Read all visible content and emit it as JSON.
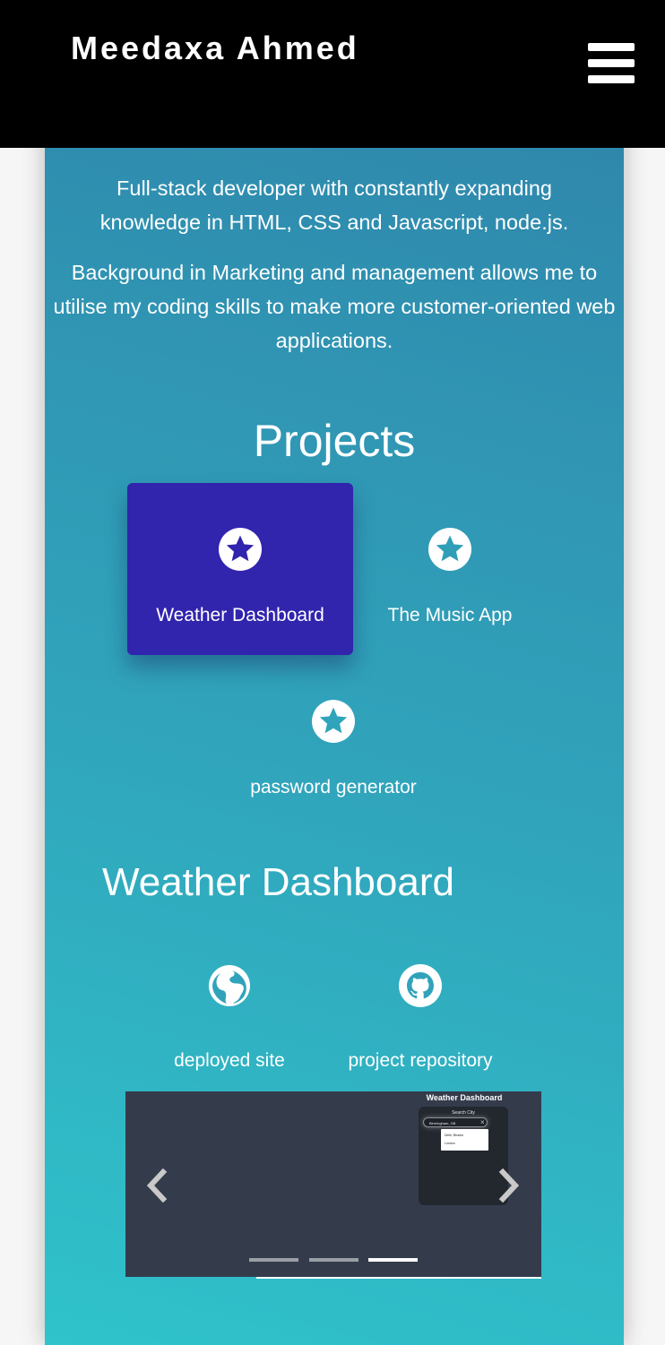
{
  "header": {
    "brand": "Meedaxa Ahmed",
    "menu_icon": "hamburger-menu-icon"
  },
  "intro": {
    "line1": "Full-stack developer with constantly expanding knowledge in HTML, CSS and Javascript, node.js.",
    "line2": "Background in Marketing and management allows me to utilise my coding skills to make more customer-oriented web applications."
  },
  "projects": {
    "title": "Projects",
    "items": [
      {
        "label": "Weather Dashboard",
        "icon": "star-icon",
        "active": true
      },
      {
        "label": "The Music App",
        "icon": "star-icon",
        "active": false
      },
      {
        "label": "password generator",
        "icon": "star-icon",
        "active": false
      }
    ]
  },
  "detail": {
    "title": "Weather Dashboard",
    "links": [
      {
        "label": "deployed site",
        "icon": "globe-icon"
      },
      {
        "label": "project repository",
        "icon": "github-icon"
      }
    ]
  },
  "carousel": {
    "slide_count": 3,
    "active_index": 2,
    "prev_icon": "chevron-left-icon",
    "next_icon": "chevron-right-icon",
    "preview": {
      "title": "Weather Dashboard",
      "search_label": "Search City",
      "input_value": "Birmingham, GB",
      "options": [
        "Delhi, Bhadur",
        "London"
      ]
    }
  },
  "colors": {
    "header_bg": "#000000",
    "panel_gradient_top": "#2f88ac",
    "panel_gradient_bottom": "#2fc3cb",
    "active_card": "#3124ad",
    "carousel_bg": "#343c4c"
  }
}
